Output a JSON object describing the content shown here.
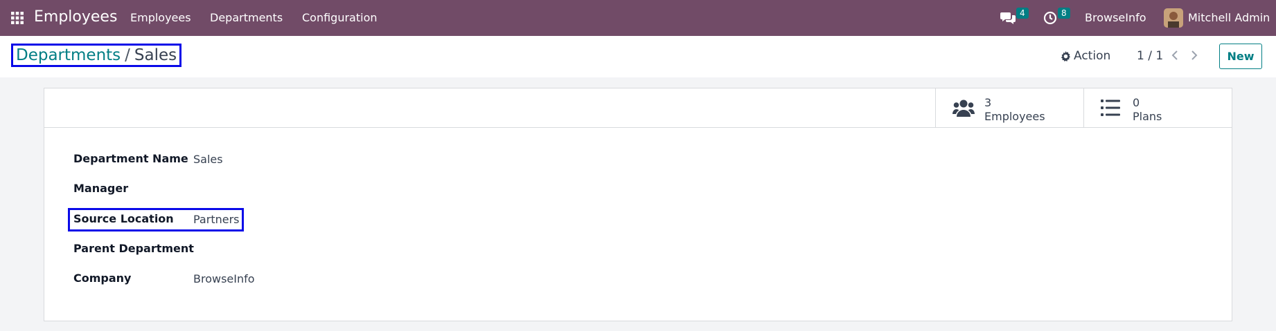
{
  "navbar": {
    "app_title": "Employees",
    "menu": [
      "Employees",
      "Departments",
      "Configuration"
    ],
    "messages_badge": "4",
    "activities_badge": "8",
    "company": "BrowseInfo",
    "user": "Mitchell Admin",
    "icons": {
      "apps": "apps-grid-icon",
      "messages": "chat-icon",
      "activities": "clock-icon",
      "avatar": "user-avatar"
    }
  },
  "control_panel": {
    "breadcrumb_parent": "Departments",
    "breadcrumb_separator": "/",
    "breadcrumb_current": "Sales",
    "action_label": "Action",
    "pager_value": "1 / 1",
    "new_label": "New"
  },
  "stat_buttons": [
    {
      "value": "3",
      "label": "Employees",
      "icon": "users-icon"
    },
    {
      "value": "0",
      "label": "Plans",
      "icon": "list-icon"
    }
  ],
  "fields": [
    {
      "label": "Department Name",
      "value": "Sales"
    },
    {
      "label": "Manager",
      "value": ""
    },
    {
      "label": "Source Location",
      "value": "Partners"
    },
    {
      "label": "Parent Department",
      "value": ""
    },
    {
      "label": "Company",
      "value": "BrowseInfo"
    }
  ],
  "colors": {
    "navbar": "#714b67",
    "accent": "#017e84",
    "highlight": "#0a0ae8"
  }
}
